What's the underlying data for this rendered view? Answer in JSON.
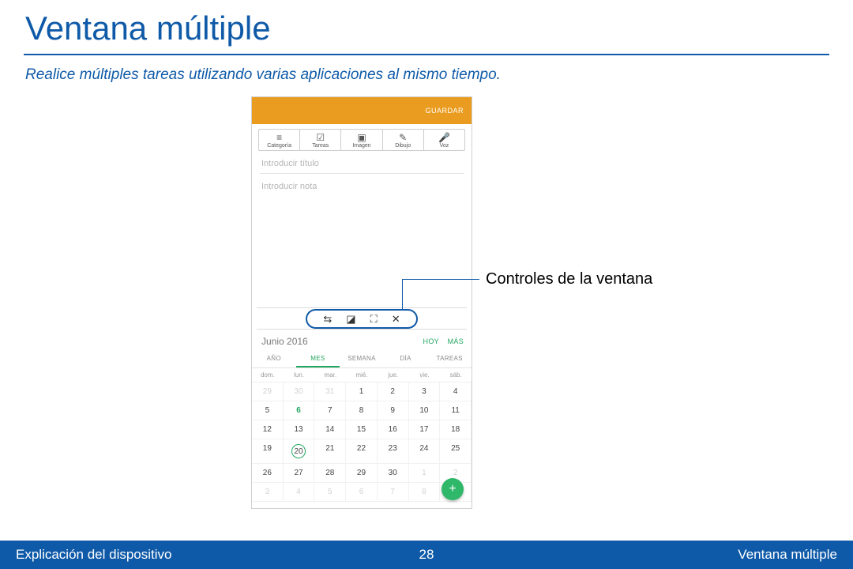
{
  "title": "Ventana múltiple",
  "subtitle": "Realice múltiples tareas utilizando varias aplicaciones al mismo tiempo.",
  "callout_label": "Controles de la ventana",
  "notes": {
    "save_label": "GUARDAR",
    "tools": [
      "Categoría",
      "Tareas",
      "Imagen",
      "Dibujo",
      "Voz"
    ],
    "tool_icons": [
      "≡",
      "☑",
      "▣",
      "✎",
      "🎤"
    ],
    "title_placeholder": "Introducir título",
    "body_placeholder": "Introducir nota"
  },
  "window_controls": {
    "icons": [
      "⇆",
      "◪",
      "⛶",
      "✕"
    ]
  },
  "calendar": {
    "month_label": "Junio 2016",
    "link_today": "HOY",
    "link_more": "MÁS",
    "tabs": [
      "AÑO",
      "MES",
      "SEMANA",
      "DÍA",
      "TAREAS"
    ],
    "active_tab": 1,
    "dow": [
      "dom.",
      "lun.",
      "mar.",
      "mié.",
      "jue.",
      "vie.",
      "sáb."
    ],
    "grid": [
      [
        "29",
        "30",
        "31",
        "1",
        "2",
        "3",
        "4"
      ],
      [
        "5",
        "6",
        "7",
        "8",
        "9",
        "10",
        "11"
      ],
      [
        "12",
        "13",
        "14",
        "15",
        "16",
        "17",
        "18"
      ],
      [
        "19",
        "20",
        "21",
        "22",
        "23",
        "24",
        "25"
      ],
      [
        "26",
        "27",
        "28",
        "29",
        "30",
        "1",
        "2"
      ],
      [
        "3",
        "4",
        "5",
        "6",
        "7",
        "8",
        ""
      ]
    ],
    "dim_rows": {
      "0": [
        0,
        1,
        2
      ],
      "4": [
        5,
        6
      ],
      "5": [
        0,
        1,
        2,
        3,
        4,
        5,
        6
      ]
    },
    "accent": {
      "row": 1,
      "col": 1
    },
    "today": {
      "row": 3,
      "col": 1
    },
    "fab_label": "+"
  },
  "footer": {
    "left": "Explicación del dispositivo",
    "page": "28",
    "right": "Ventana múltiple"
  }
}
